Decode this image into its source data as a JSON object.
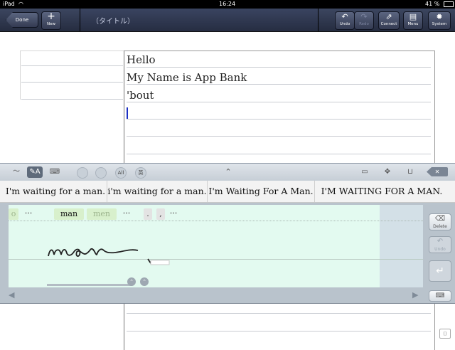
{
  "status_bar": {
    "device": "iPad",
    "wifi_icon": "wifi-icon",
    "time": "16:24",
    "battery": "41 %"
  },
  "toolbar": {
    "done_label": "Done",
    "new_label": "New",
    "title": "（タイトル）",
    "undo_label": "Undo",
    "redo_label": "Redo",
    "connect_label": "Connect",
    "menu_label": "Menu",
    "system_label": "System"
  },
  "document": {
    "lines": [
      "Hello",
      "My Name is App Bank",
      "'bout"
    ]
  },
  "handwriting_panel": {
    "mode_all_label": "All",
    "mode_lang_label": "英",
    "candidates": [
      "I'm waiting for a man.",
      "i'm waiting for a man.",
      "I'm Waiting For A Man.",
      "I'M WAITING FOR A MAN."
    ],
    "word_chips": [
      "o",
      "•••",
      "man",
      "men",
      "•••",
      ".",
      ",",
      "•••"
    ],
    "handwriting_text": "man",
    "delete_label": "Delete",
    "undo_label": "Undo"
  },
  "colors": {
    "toolbar_bg": "#2f3650",
    "writing_area_bg": "#e3faf0",
    "cursor": "#1b2fc4",
    "selected_chip": "#d8f0cc"
  }
}
